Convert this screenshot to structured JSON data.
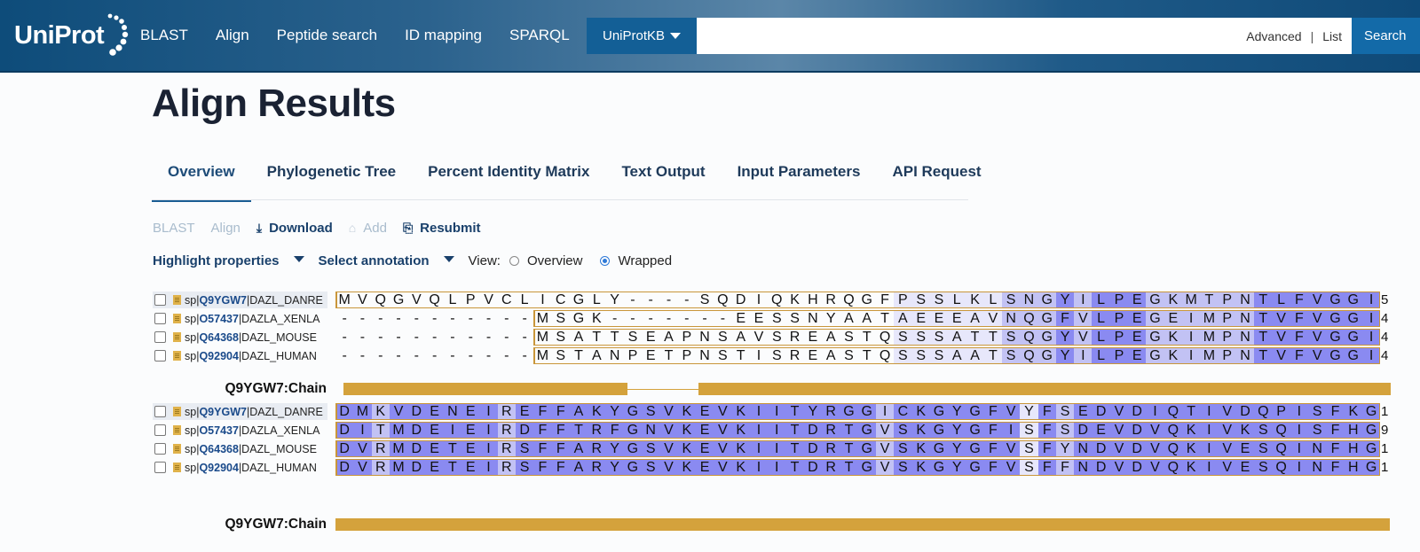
{
  "header": {
    "logo_text": "UniProt",
    "nav": [
      "BLAST",
      "Align",
      "Peptide search",
      "ID mapping",
      "SPARQL"
    ],
    "db_select": "UniProtKB",
    "search_placeholder": "",
    "advanced": "Advanced",
    "separator": "|",
    "list": "List",
    "search_button": "Search"
  },
  "page": {
    "title": "Align Results"
  },
  "tabs": [
    "Overview",
    "Phylogenetic Tree",
    "Percent Identity Matrix",
    "Text Output",
    "Input Parameters",
    "API Request"
  ],
  "toolbar": {
    "blast": "BLAST",
    "align": "Align",
    "download": "Download",
    "add": "Add",
    "resubmit": "Resubmit"
  },
  "options": {
    "highlight": "Highlight properties",
    "annotation": "Select annotation",
    "view_label": "View:",
    "view_overview": "Overview",
    "view_wrapped": "Wrapped",
    "selected_view": "Wrapped"
  },
  "alignment": {
    "blocks": [
      {
        "chain_label": "Q9YGW7:Chain",
        "rows": [
          {
            "db": "sp",
            "sep1": "|",
            "accession": "Q9YGW7",
            "name": "|DAZL_DANRE",
            "sequence": "MVQGVQLPVCLICGLY----SQDIQKHRQGFPSSLKLSNGYILPEGKMTPNTLFVGGI",
            "shade": "0000000000000000000000000000000111111222323332222223333333",
            "tail": "5"
          },
          {
            "db": "sp",
            "sep1": "|",
            "accession": "O57437",
            "name": "|DAZLA_XENLA",
            "sequence": "-----------MSGK-------EESSNYAATAEEEAVNQGFVLPEGEIMPNTVFVGGI",
            "shade": "0000000000000000000000000000000111111222323332222223333333",
            "tail": "4"
          },
          {
            "db": "sp",
            "sep1": "|",
            "accession": "Q64368",
            "name": "|DAZL_MOUSE",
            "sequence": "-----------MSATTSEAPNSAVSREASTQSSSATTSQGYVLPEGKIMPNTVFVGGI",
            "shade": "0000000000000000000000000000000111111222323332222223333333",
            "tail": "4"
          },
          {
            "db": "sp",
            "sep1": "|",
            "accession": "Q92904",
            "name": "|DAZL_HUMAN",
            "sequence": "-----------MSTANPETPNSTISREASTQSSSAATSQGYILPEGKIMPNTVFVGGI",
            "shade": "0000000000000000000000000000000111111222323332222223333333",
            "tail": "4"
          }
        ]
      },
      {
        "chain_label": "Q9YGW7:Chain",
        "rows": [
          {
            "db": "sp",
            "sep1": "|",
            "accession": "Q9YGW7",
            "name": "|DAZL_DANRE",
            "sequence": "DMKVDENEIREFFAKYGSVKEVKIITYRGGICKGYGFVYFSEDVDIQTIVDQPISFKG",
            "shade": "3323333332333333333333333333332333333313233333333333333333",
            "tail": "1"
          },
          {
            "db": "sp",
            "sep1": "|",
            "accession": "O57437",
            "name": "|DAZLA_XENLA",
            "sequence": "DITMDEIEIRDFFTRFGNVKEVKIITDRTGVSKGYGFISFSDEVDVQKIVKSQISFHG",
            "shade": "3323333332333333333333333333332333333313233333333333333333",
            "tail": "9"
          },
          {
            "db": "sp",
            "sep1": "|",
            "accession": "Q64368",
            "name": "|DAZL_MOUSE",
            "sequence": "DVRMDETEIRSFFARYGSVKEVKIITDRTGVSKGYGFVSFYNDVDVQKIVESQINFHG",
            "shade": "3323333332333333333333333333332333333313233333333333333333",
            "tail": "1"
          },
          {
            "db": "sp",
            "sep1": "|",
            "accession": "Q92904",
            "name": "|DAZL_HUMAN",
            "sequence": "DVRMDETEIRSFFARYGSVKEVKIITDRTGVSKGYGFVSFFNDVDVQKIVESQINFHG",
            "shade": "3323333332333333333333333333332333333313233333333333333333",
            "tail": "1"
          }
        ]
      }
    ]
  },
  "colors": {
    "header_bg": "#2b628d",
    "accent": "#1a5d93",
    "chain": "#d4a23c",
    "box": "#c9963a"
  }
}
